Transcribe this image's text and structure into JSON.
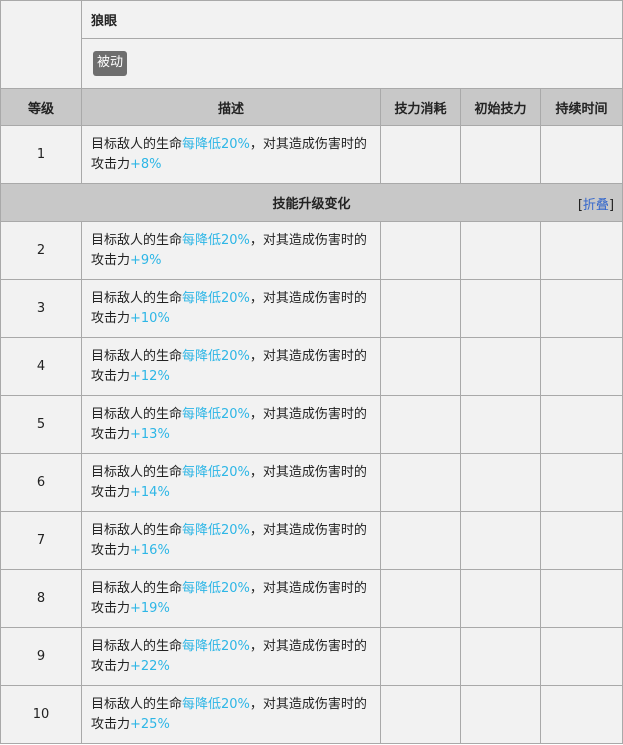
{
  "skill": {
    "name": "狼眼",
    "tag": "被动"
  },
  "headers": {
    "level": "等级",
    "desc": "描述",
    "cost": "技力消耗",
    "initial": "初始技力",
    "duration": "持续时间"
  },
  "upgrade": {
    "title": "技能升级变化",
    "bracket_open": "[",
    "fold_label": "折叠",
    "bracket_close": "]"
  },
  "rows": [
    {
      "level": "1",
      "desc_a": "目标敌人的生命",
      "desc_b": "每降低20%",
      "desc_c": "，对其造成伤害时的攻击力",
      "desc_d": "+8%"
    },
    {
      "level": "2",
      "desc_a": "目标敌人的生命",
      "desc_b": "每降低20%",
      "desc_c": "，对其造成伤害时的攻击力",
      "desc_d": "+9%"
    },
    {
      "level": "3",
      "desc_a": "目标敌人的生命",
      "desc_b": "每降低20%",
      "desc_c": "，对其造成伤害时的攻击力",
      "desc_d": "+10%"
    },
    {
      "level": "4",
      "desc_a": "目标敌人的生命",
      "desc_b": "每降低20%",
      "desc_c": "，对其造成伤害时的攻击力",
      "desc_d": "+12%"
    },
    {
      "level": "5",
      "desc_a": "目标敌人的生命",
      "desc_b": "每降低20%",
      "desc_c": "，对其造成伤害时的攻击力",
      "desc_d": "+13%"
    },
    {
      "level": "6",
      "desc_a": "目标敌人的生命",
      "desc_b": "每降低20%",
      "desc_c": "，对其造成伤害时的攻击力",
      "desc_d": "+14%"
    },
    {
      "level": "7",
      "desc_a": "目标敌人的生命",
      "desc_b": "每降低20%",
      "desc_c": "，对其造成伤害时的攻击力",
      "desc_d": "+16%"
    },
    {
      "level": "8",
      "desc_a": "目标敌人的生命",
      "desc_b": "每降低20%",
      "desc_c": "，对其造成伤害时的攻击力",
      "desc_d": "+19%"
    },
    {
      "level": "9",
      "desc_a": "目标敌人的生命",
      "desc_b": "每降低20%",
      "desc_c": "，对其造成伤害时的攻击力",
      "desc_d": "+22%"
    },
    {
      "level": "10",
      "desc_a": "目标敌人的生命",
      "desc_b": "每降低20%",
      "desc_c": "，对其造成伤害时的攻击力",
      "desc_d": "+25%"
    }
  ]
}
